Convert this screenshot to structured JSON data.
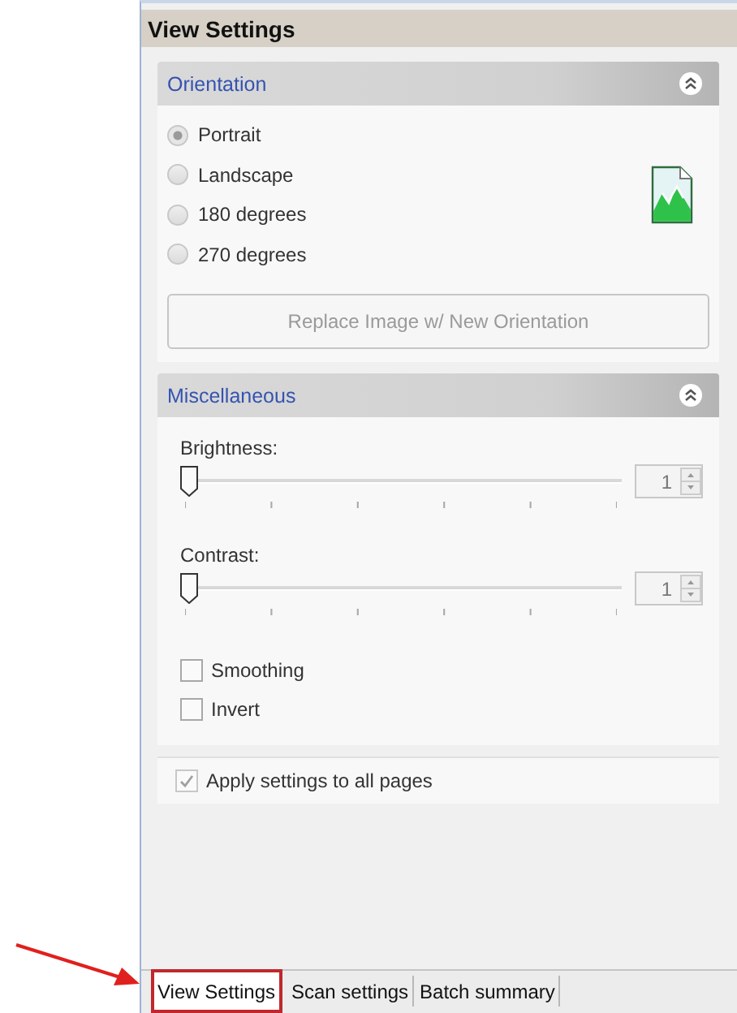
{
  "panel": {
    "title": "View Settings"
  },
  "orientation": {
    "title": "Orientation",
    "options": [
      {
        "label": "Portrait",
        "selected": true
      },
      {
        "label": "Landscape",
        "selected": false
      },
      {
        "label": "180 degrees",
        "selected": false
      },
      {
        "label": "270 degrees",
        "selected": false
      }
    ],
    "button": {
      "label": "Replace Image w/ New Orientation",
      "disabled": true
    }
  },
  "miscellaneous": {
    "title": "Miscellaneous",
    "sliders": [
      {
        "label": "Brightness:",
        "level": 0,
        "value": "1"
      },
      {
        "label": "Contrast:",
        "level": 0,
        "value": "1"
      }
    ],
    "checkboxes": [
      {
        "label": "Smoothing",
        "checked": false
      },
      {
        "label": "Invert",
        "checked": false
      }
    ]
  },
  "apply": {
    "label": "Apply settings to all pages",
    "checked": true,
    "disabled": true
  },
  "tabs": [
    {
      "label": "View Settings",
      "selected": true
    },
    {
      "label": "Scan settings",
      "selected": false
    },
    {
      "label": "Batch summary",
      "selected": false
    }
  ]
}
